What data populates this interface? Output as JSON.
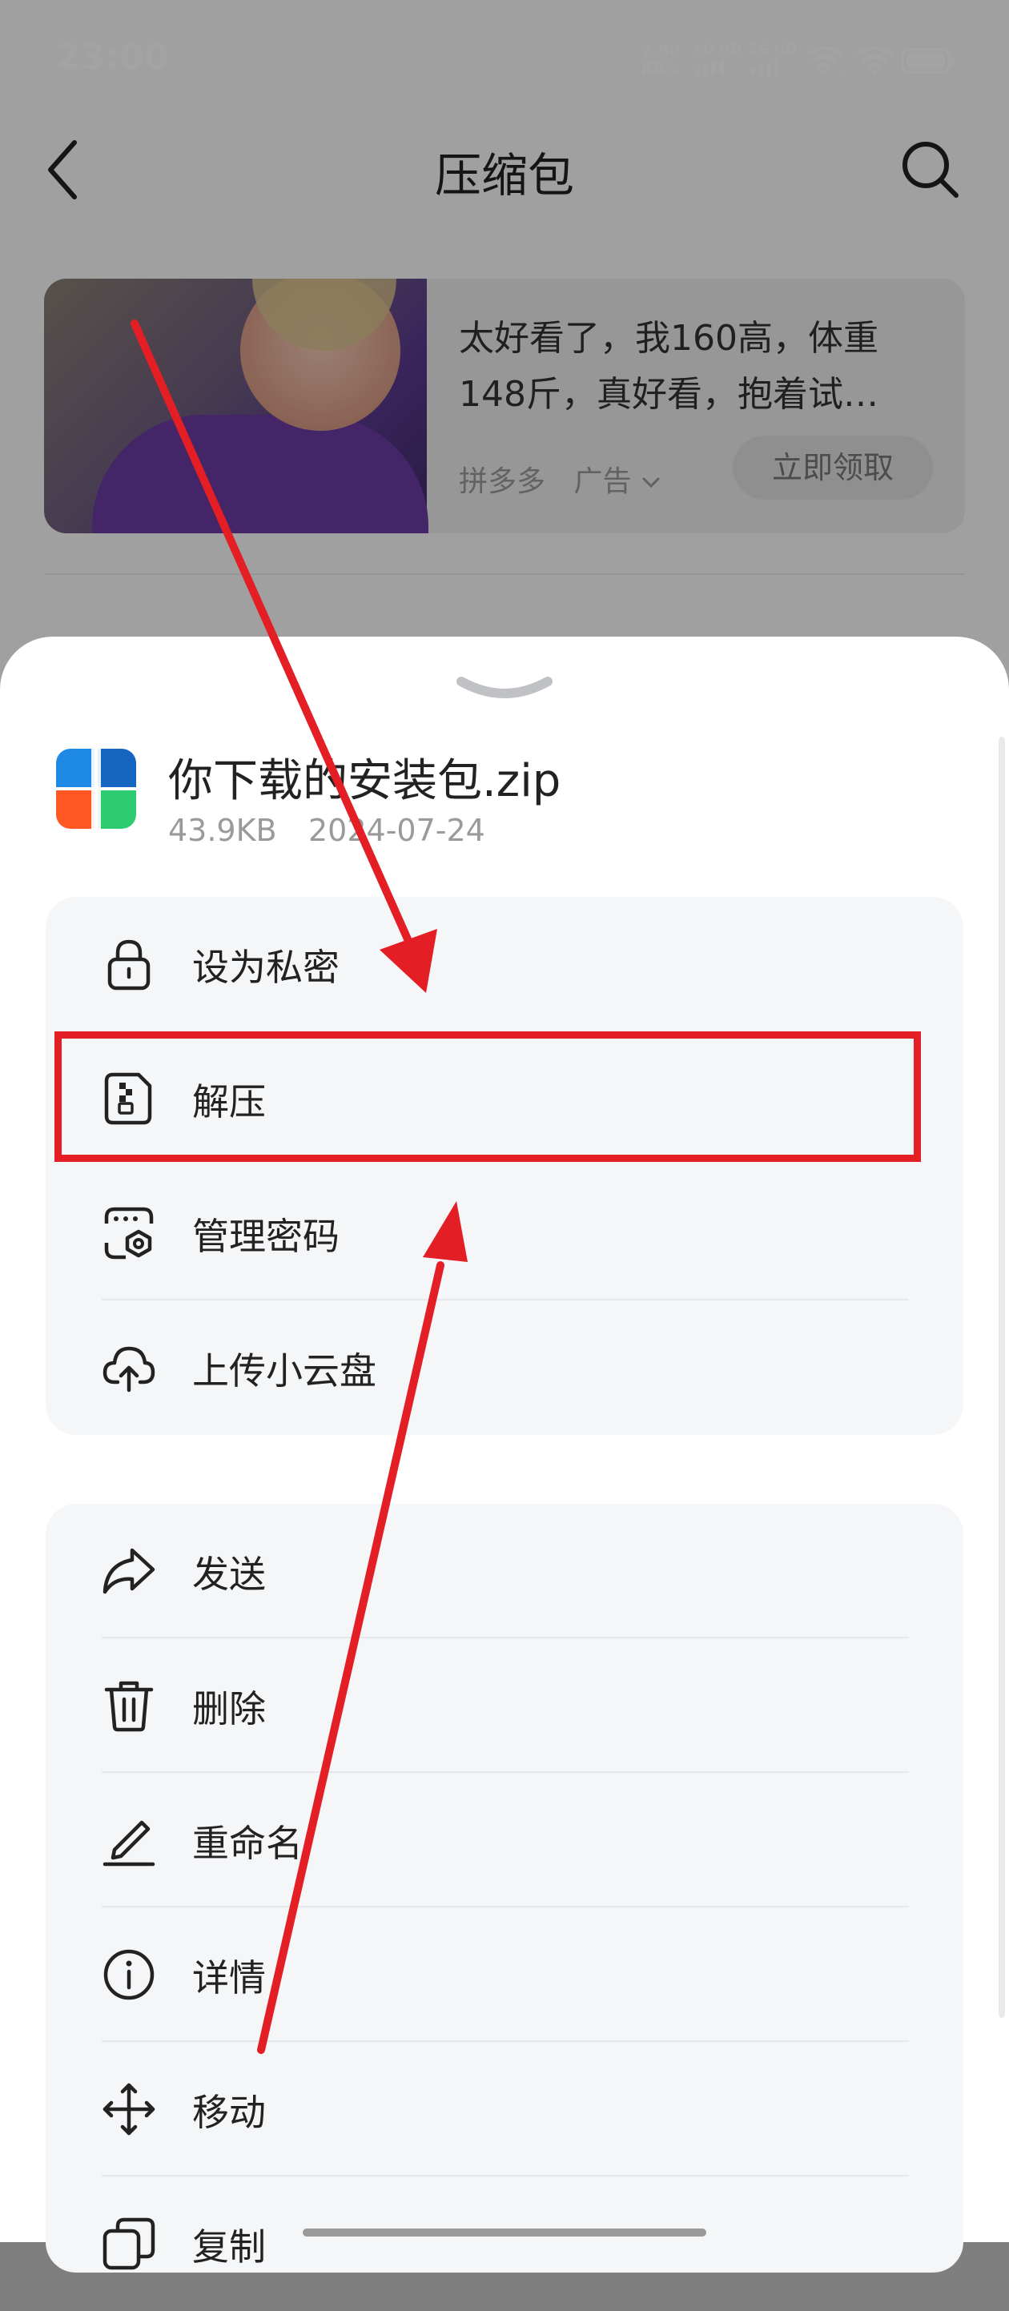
{
  "status_bar": {
    "time": "23:00",
    "net_speed_value": "2.90",
    "net_speed_unit": "KB/s",
    "sim1_label": "5G HD",
    "sim2_label": "5G HD"
  },
  "header": {
    "title": "压缩包",
    "back_icon": "chevron-left-icon",
    "search_icon": "search-icon"
  },
  "ad": {
    "text": "太好看了，我160高，体重148斤，真好看，抱着试…",
    "source": "拼多多",
    "tag": "广告",
    "button": "立即领取"
  },
  "file": {
    "name": "你下载的安装包.zip",
    "size": "43.9KB",
    "date": "2024-07-24"
  },
  "menu_group_1": [
    {
      "label": "设为私密",
      "icon": "lock-icon"
    },
    {
      "label": "解压",
      "icon": "unzip-icon"
    },
    {
      "label": "管理密码",
      "icon": "manage-password-icon"
    },
    {
      "label": "上传小云盘",
      "icon": "cloud-upload-icon"
    }
  ],
  "menu_group_2": [
    {
      "label": "发送",
      "icon": "send-icon"
    },
    {
      "label": "删除",
      "icon": "trash-icon"
    },
    {
      "label": "重命名",
      "icon": "rename-icon"
    },
    {
      "label": "详情",
      "icon": "info-icon"
    },
    {
      "label": "移动",
      "icon": "move-icon"
    },
    {
      "label": "复制",
      "icon": "copy-icon"
    }
  ],
  "colors": {
    "annotation_red": "#e31e24",
    "menu_background": "#f5f6f8"
  }
}
